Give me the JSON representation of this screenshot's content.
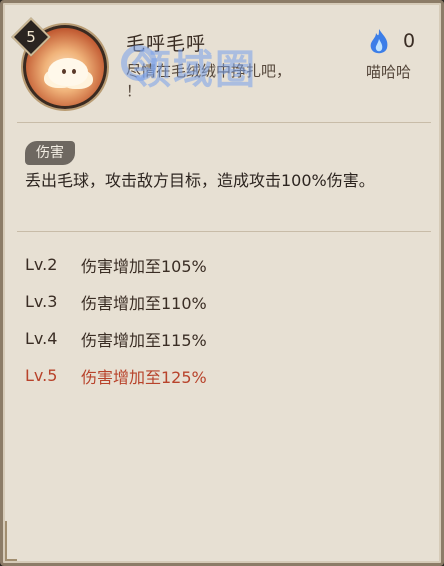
{
  "skill": {
    "level": "5",
    "name": "毛呼毛呼",
    "quote": "尽情在毛绒绒中挣扎吧，",
    "quote_tail": "喵哈哈",
    "quote_end": "！",
    "cost": "0"
  },
  "watermark": "领域圈",
  "tag": "伤害",
  "description": "丢出毛球，攻击敌方目标，造成攻击100%伤害。",
  "levels": [
    {
      "level": "Lv.2",
      "text": "伤害增加至105%"
    },
    {
      "level": "Lv.3",
      "text": "伤害增加至110%"
    },
    {
      "level": "Lv.4",
      "text": "伤害增加至115%"
    },
    {
      "level": "Lv.5",
      "text": "伤害增加至125%"
    }
  ],
  "colors": {
    "active_level": "#b8432b",
    "text": "#3a2d24",
    "panel": "#e7e0d3"
  }
}
